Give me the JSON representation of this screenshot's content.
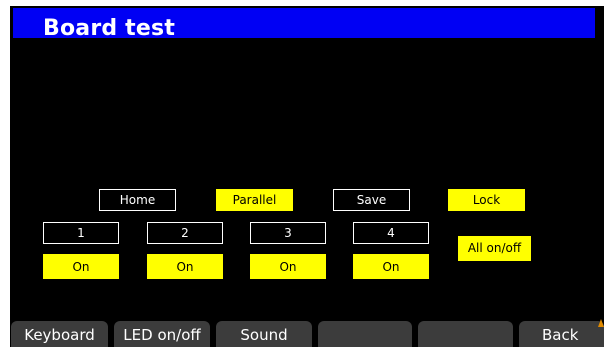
{
  "header": {
    "title": "Board test"
  },
  "controls": {
    "home": "Home",
    "parallel": "Parallel",
    "save": "Save",
    "lock": "Lock",
    "all_on_off": "All on/off"
  },
  "channels": [
    {
      "label": "1",
      "state": "On"
    },
    {
      "label": "2",
      "state": "On"
    },
    {
      "label": "3",
      "state": "On"
    },
    {
      "label": "4",
      "state": "On"
    }
  ],
  "softkeys": {
    "keyboard": "Keyboard",
    "led_on_off": "LED on/off",
    "sound": "Sound",
    "empty_1": "",
    "empty_2": "",
    "back": "Back"
  },
  "colors": {
    "title_bar": "#0000f4",
    "highlight": "#ffff00",
    "softkey": "#3c3c3c",
    "scroll_arrow": "#e08a00"
  },
  "icons": {
    "softkey_scroll": "scroll-up-arrow-icon"
  }
}
